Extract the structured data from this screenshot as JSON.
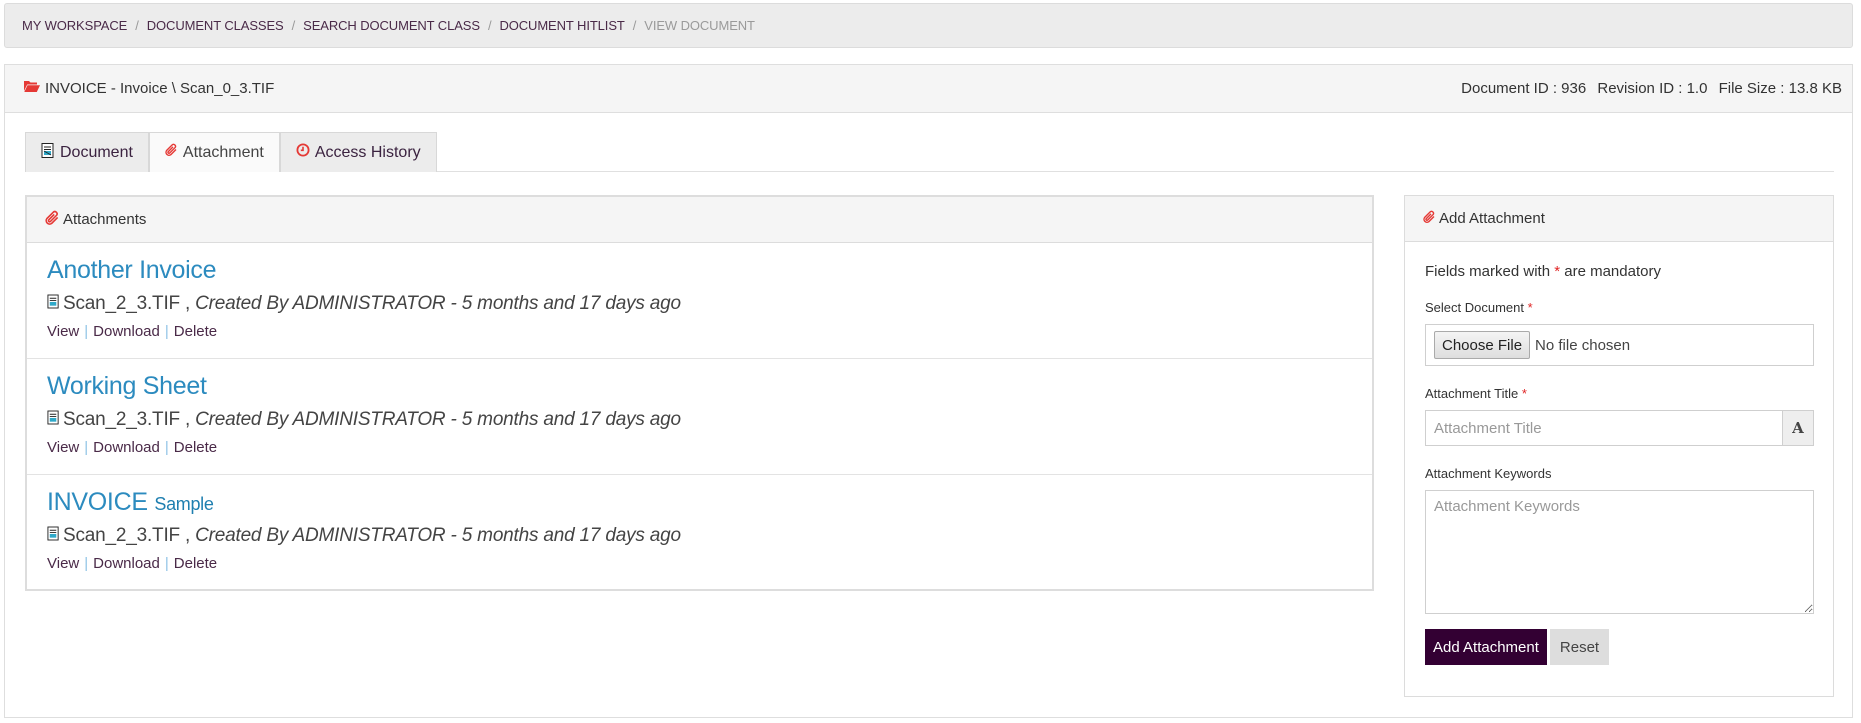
{
  "breadcrumb": [
    {
      "label": "MY WORKSPACE"
    },
    {
      "label": "DOCUMENT CLASSES"
    },
    {
      "label": "SEARCH DOCUMENT CLASS"
    },
    {
      "label": "DOCUMENT HITLIST"
    },
    {
      "label": "VIEW DOCUMENT"
    }
  ],
  "breadcrumb_separator": "/",
  "document": {
    "title": "INVOICE - Invoice \\ Scan_0_3.TIF",
    "document_id": "Document ID : 936",
    "revision_id": "Revision ID : 1.0",
    "file_size": "File Size : 13.8 KB"
  },
  "tabs": [
    {
      "label": "Document",
      "icon": "document-icon"
    },
    {
      "label": "Attachment",
      "icon": "paperclip-icon",
      "active": true
    },
    {
      "label": "Access History",
      "icon": "clock-icon"
    }
  ],
  "attachments_panel": {
    "title": "Attachments",
    "items": [
      {
        "title": "Another Invoice",
        "subtitle": "",
        "file": "Scan_2_3.TIF ,",
        "created": "Created By ADMINISTRATOR - 5 months and 17 days ago",
        "actions": [
          "View",
          "Download",
          "Delete"
        ]
      },
      {
        "title": "Working Sheet",
        "subtitle": "",
        "file": "Scan_2_3.TIF ,",
        "created": "Created By ADMINISTRATOR - 5 months and 17 days ago",
        "actions": [
          "View",
          "Download",
          "Delete"
        ]
      },
      {
        "title": "INVOICE",
        "subtitle": "Sample",
        "file": "Scan_2_3.TIF ,",
        "created": "Created By ADMINISTRATOR - 5 months and 17 days ago",
        "actions": [
          "View",
          "Download",
          "Delete"
        ]
      }
    ]
  },
  "add_attachment": {
    "title": "Add Attachment",
    "mandatory_prefix": "Fields marked with",
    "mandatory_star": "*",
    "mandatory_suffix": "are mandatory",
    "select_document_label": "Select Document",
    "choose_file_label": "Choose File",
    "no_file_text": "No file chosen",
    "title_label": "Attachment Title",
    "title_value": "",
    "title_placeholder": "Attachment Title",
    "title_addon": "A",
    "keywords_label": "Attachment Keywords",
    "keywords_value": "",
    "keywords_placeholder": "Attachment Keywords",
    "submit_label": "Add Attachment",
    "reset_label": "Reset"
  },
  "colors": {
    "accent_dark": "#330033",
    "link": "#4a2a48",
    "title_link": "#2c8bbf",
    "required": "#e02424",
    "icon_red": "#e53935"
  }
}
